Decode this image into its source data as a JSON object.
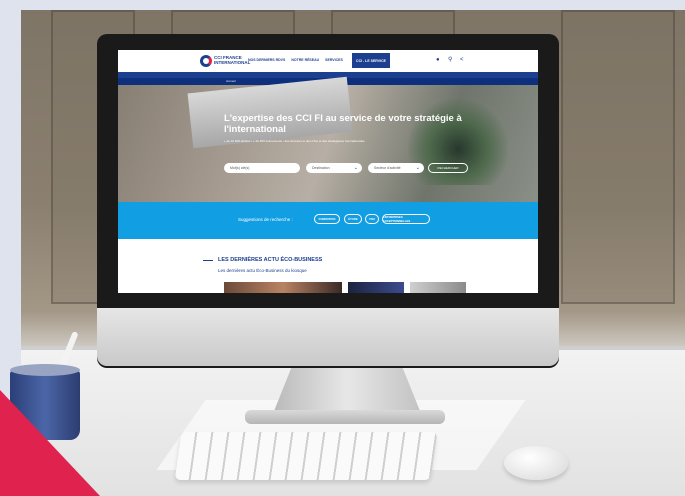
{
  "website": {
    "logo_text": "CCI FRANCE INTERNATIONAL",
    "nav": [
      "NOS DERNIERS RDVS",
      "NOTRE RÉSEAU",
      "SERVICES"
    ],
    "nav_cta": "CCI - LE SERVICE",
    "breadcrumb": "Accueil",
    "hero": {
      "title": "L'expertise des CCI FI au service de votre stratégie à l'international",
      "subtitle": "+ de 10 000 articles • + de 400 événements • des données et des infos et des stratégiques internationales",
      "field_keyword": "Mot(s) clé(s)",
      "field_country": "Destination",
      "field_sector": "Secteur d'activité",
      "search_label": "RECHERCHER"
    },
    "suggestions": {
      "label": "Suggestions de recherche :",
      "chips": [
        "FORMATION",
        "ÉTUDE",
        "VIVA",
        "ENTREPRISES EXCEPTIONNELLES"
      ]
    },
    "latest": {
      "title": "LES DERNIÈRES ACTU ÉCO-BUSINESS",
      "subtitle": "Les dernières actu Éco-Business du kiosque"
    }
  },
  "colors": {
    "brand_navy": "#1d3f8f",
    "brand_blue": "#129ee3",
    "accent_red": "#e0234e"
  }
}
